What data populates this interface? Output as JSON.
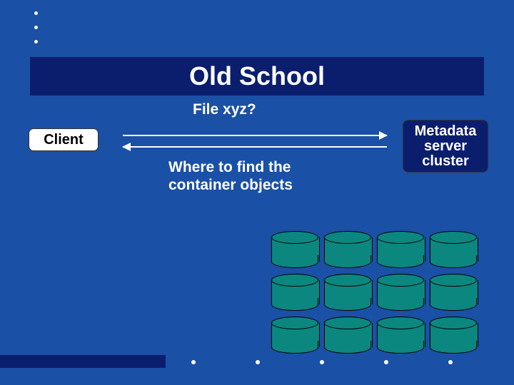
{
  "title": "Old School",
  "subtitle": "File xyz?",
  "client_label": "Client",
  "metadata_label": "Metadata server cluster",
  "caption": "Where to find the container objects",
  "cylinder_rows": 3,
  "cylinder_cols": 4,
  "colors": {
    "slide_bg": "#1a50a6",
    "banner_bg": "#0b1e6e",
    "cylinder_fill": "#0b877f"
  }
}
